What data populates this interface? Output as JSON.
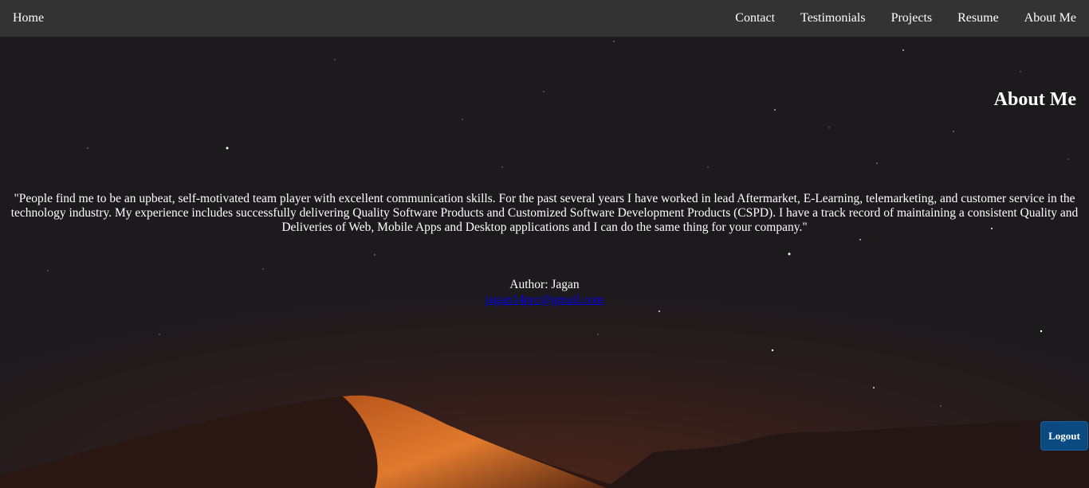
{
  "nav": {
    "home": "Home",
    "links": [
      "Contact",
      "Testimonials",
      "Projects",
      "Resume",
      "About Me"
    ]
  },
  "section": {
    "heading": "About Me",
    "quote": "\"People find me to be an upbeat, self-motivated team player with excellent communication skills. For the past several years I have worked in lead Aftermarket, E-Learning, telemarketing, and customer service in the technology industry. My experience includes successfully delivering Quality Software Products and Customized Software Development Products (CSPD). I have a track record of maintaining a consistent Quality and Deliveries of Web, Mobile Apps and Desktop applications and I can do the same thing for your company.\"",
    "author": "Author: Jagan",
    "email": "jagan14prc@gmail.com"
  },
  "logout_label": "Logout",
  "colors": {
    "navbar": "#333333",
    "background": "#1c1a1d",
    "logout": "#0a4a80",
    "link": "#0000ee"
  }
}
